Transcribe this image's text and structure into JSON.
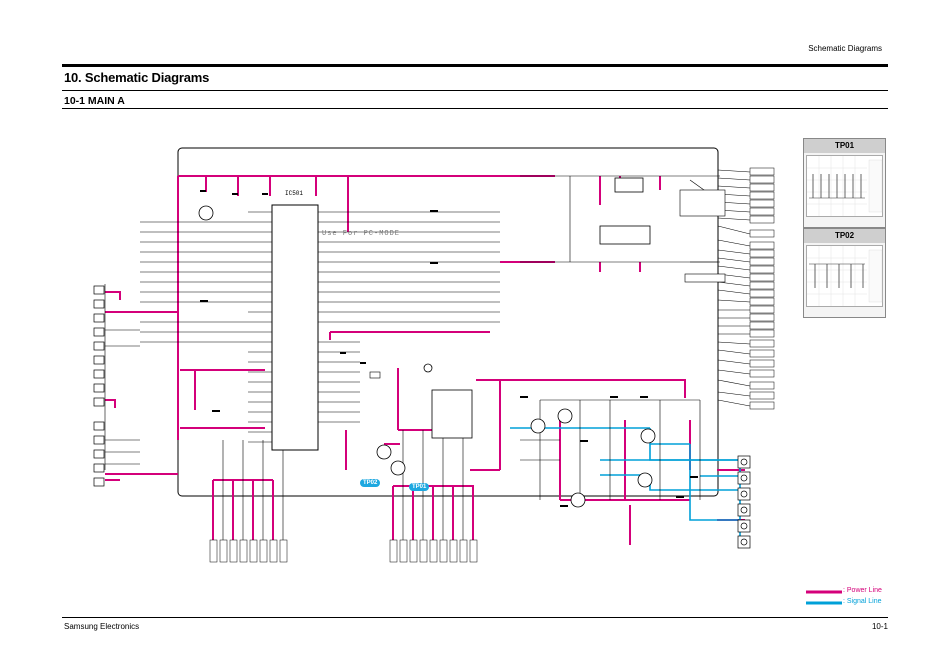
{
  "header": {
    "section": "Schematic Diagrams"
  },
  "title": "10. Schematic Diagrams",
  "subtitle": "10-1 MAIN A",
  "ic_main": {
    "name": "IC501",
    "note": "Use For PC-MODE"
  },
  "test_points": [
    {
      "name": "TP01"
    },
    {
      "name": "TP02"
    }
  ],
  "tp_markers": [
    "TP02",
    "TP01"
  ],
  "legend": {
    "power": ": Power Line",
    "signal": ": Signal Line",
    "power_color": "#d4007a",
    "signal_color": "#00a0d8"
  },
  "footer": {
    "company": "Samsung Electronics",
    "page": "10-1"
  }
}
